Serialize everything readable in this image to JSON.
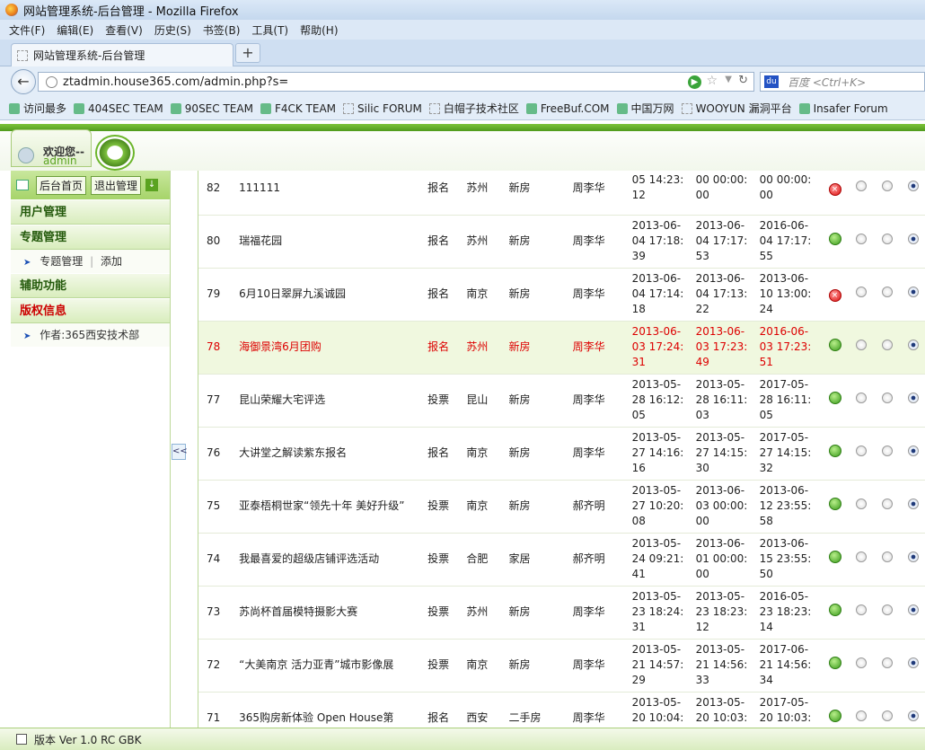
{
  "window": {
    "title": "网站管理系统-后台管理 - Mozilla Firefox"
  },
  "menu": [
    "文件(F)",
    "编辑(E)",
    "查看(V)",
    "历史(S)",
    "书签(B)",
    "工具(T)",
    "帮助(H)"
  ],
  "tab": {
    "title": "网站管理系统-后台管理",
    "new": "+"
  },
  "nav": {
    "url": "ztadmin.house365.com/admin.php?s=",
    "search_placeholder": "百度 <Ctrl+K>"
  },
  "bookmarks": [
    "访问最多",
    "404SEC TEAM",
    "90SEC TEAM",
    "F4CK TEAM",
    "Silic FORUM",
    "白帽子技术社区",
    "FreeBuf.COM",
    "中国万网",
    "WOOYUN 漏洞平台",
    "Insafer Forum"
  ],
  "header": {
    "welcome": "欢迎您--",
    "user": "admin"
  },
  "sidebar": {
    "home_btn": "后台首页",
    "logout_btn": "退出管理",
    "sections": {
      "user": "用户管理",
      "topic": "专题管理",
      "aux": "辅助功能",
      "copyright": "版权信息"
    },
    "topic_manage": "专题管理",
    "topic_sep": "|",
    "topic_add": "添加",
    "author": "作者:365西安技术部",
    "collapse": "<<"
  },
  "rows": [
    {
      "id": "82",
      "name": "111111",
      "type": "报名",
      "city": "苏州",
      "cat": "新房",
      "author": "周李华",
      "d1": "05 14:23:\n12",
      "d2": "00 00:00:\n00",
      "d3": "00 00:00:\n00",
      "ok": false,
      "hl": false
    },
    {
      "id": "80",
      "name": "瑞福花园",
      "type": "报名",
      "city": "苏州",
      "cat": "新房",
      "author": "周李华",
      "d1": "2013-06-\n04 17:18:\n39",
      "d2": "2013-06-\n04 17:17:\n53",
      "d3": "2016-06-\n04 17:17:\n55",
      "ok": true,
      "hl": false
    },
    {
      "id": "79",
      "name": "6月10日翠屏九溪诚园",
      "type": "报名",
      "city": "南京",
      "cat": "新房",
      "author": "周李华",
      "d1": "2013-06-\n04 17:14:\n18",
      "d2": "2013-06-\n04 17:13:\n22",
      "d3": "2013-06-\n10 13:00:\n24",
      "ok": false,
      "hl": false
    },
    {
      "id": "78",
      "name": "海御景湾6月团购",
      "type": "报名",
      "city": "苏州",
      "cat": "新房",
      "author": "周李华",
      "d1": "2013-06-\n03 17:24:\n31",
      "d2": "2013-06-\n03 17:23:\n49",
      "d3": "2016-06-\n03 17:23:\n51",
      "ok": true,
      "hl": true
    },
    {
      "id": "77",
      "name": "昆山荣耀大宅评选",
      "type": "投票",
      "city": "昆山",
      "cat": "新房",
      "author": "周李华",
      "d1": "2013-05-\n28 16:12:\n05",
      "d2": "2013-05-\n28 16:11:\n03",
      "d3": "2017-05-\n28 16:11:\n05",
      "ok": true,
      "hl": false
    },
    {
      "id": "76",
      "name": "大讲堂之解读紫东报名",
      "type": "报名",
      "city": "南京",
      "cat": "新房",
      "author": "周李华",
      "d1": "2013-05-\n27 14:16:\n16",
      "d2": "2013-05-\n27 14:15:\n30",
      "d3": "2017-05-\n27 14:15:\n32",
      "ok": true,
      "hl": false
    },
    {
      "id": "75",
      "name": "亚泰梧桐世家“领先十年 美好升级”",
      "type": "投票",
      "city": "南京",
      "cat": "新房",
      "author": "郝齐明",
      "d1": "2013-05-\n27 10:20:\n08",
      "d2": "2013-06-\n03 00:00:\n00",
      "d3": "2013-06-\n12 23:55:\n58",
      "ok": true,
      "hl": false
    },
    {
      "id": "74",
      "name": "我最喜爱的超级店铺评选活动",
      "type": "投票",
      "city": "合肥",
      "cat": "家居",
      "author": "郝齐明",
      "d1": "2013-05-\n24 09:21:\n41",
      "d2": "2013-06-\n01 00:00:\n00",
      "d3": "2013-06-\n15 23:55:\n50",
      "ok": true,
      "hl": false
    },
    {
      "id": "73",
      "name": "苏尚杯首届模特摄影大赛",
      "type": "投票",
      "city": "苏州",
      "cat": "新房",
      "author": "周李华",
      "d1": "2013-05-\n23 18:24:\n31",
      "d2": "2013-05-\n23 18:23:\n12",
      "d3": "2016-05-\n23 18:23:\n14",
      "ok": true,
      "hl": false
    },
    {
      "id": "72",
      "name": "“大美南京 活力亚青”城市影像展",
      "type": "投票",
      "city": "南京",
      "cat": "新房",
      "author": "周李华",
      "d1": "2013-05-\n21 14:57:\n29",
      "d2": "2013-05-\n21 14:56:\n33",
      "d3": "2017-06-\n21 14:56:\n34",
      "ok": true,
      "hl": false
    },
    {
      "id": "71",
      "name": "365购房新体验 Open House第",
      "type": "报名",
      "city": "西安",
      "cat": "二手房",
      "author": "周李华",
      "d1": "2013-05-\n20 10:04:\n13",
      "d2": "2013-05-\n20 10:03:\n33",
      "d3": "2017-05-\n20 10:03:\n35",
      "ok": true,
      "hl": false
    }
  ],
  "status": {
    "version": "版本 Ver 1.0 RC GBK"
  },
  "colors": {
    "accent": "#5aa320",
    "highlight_text": "#dd0000"
  }
}
